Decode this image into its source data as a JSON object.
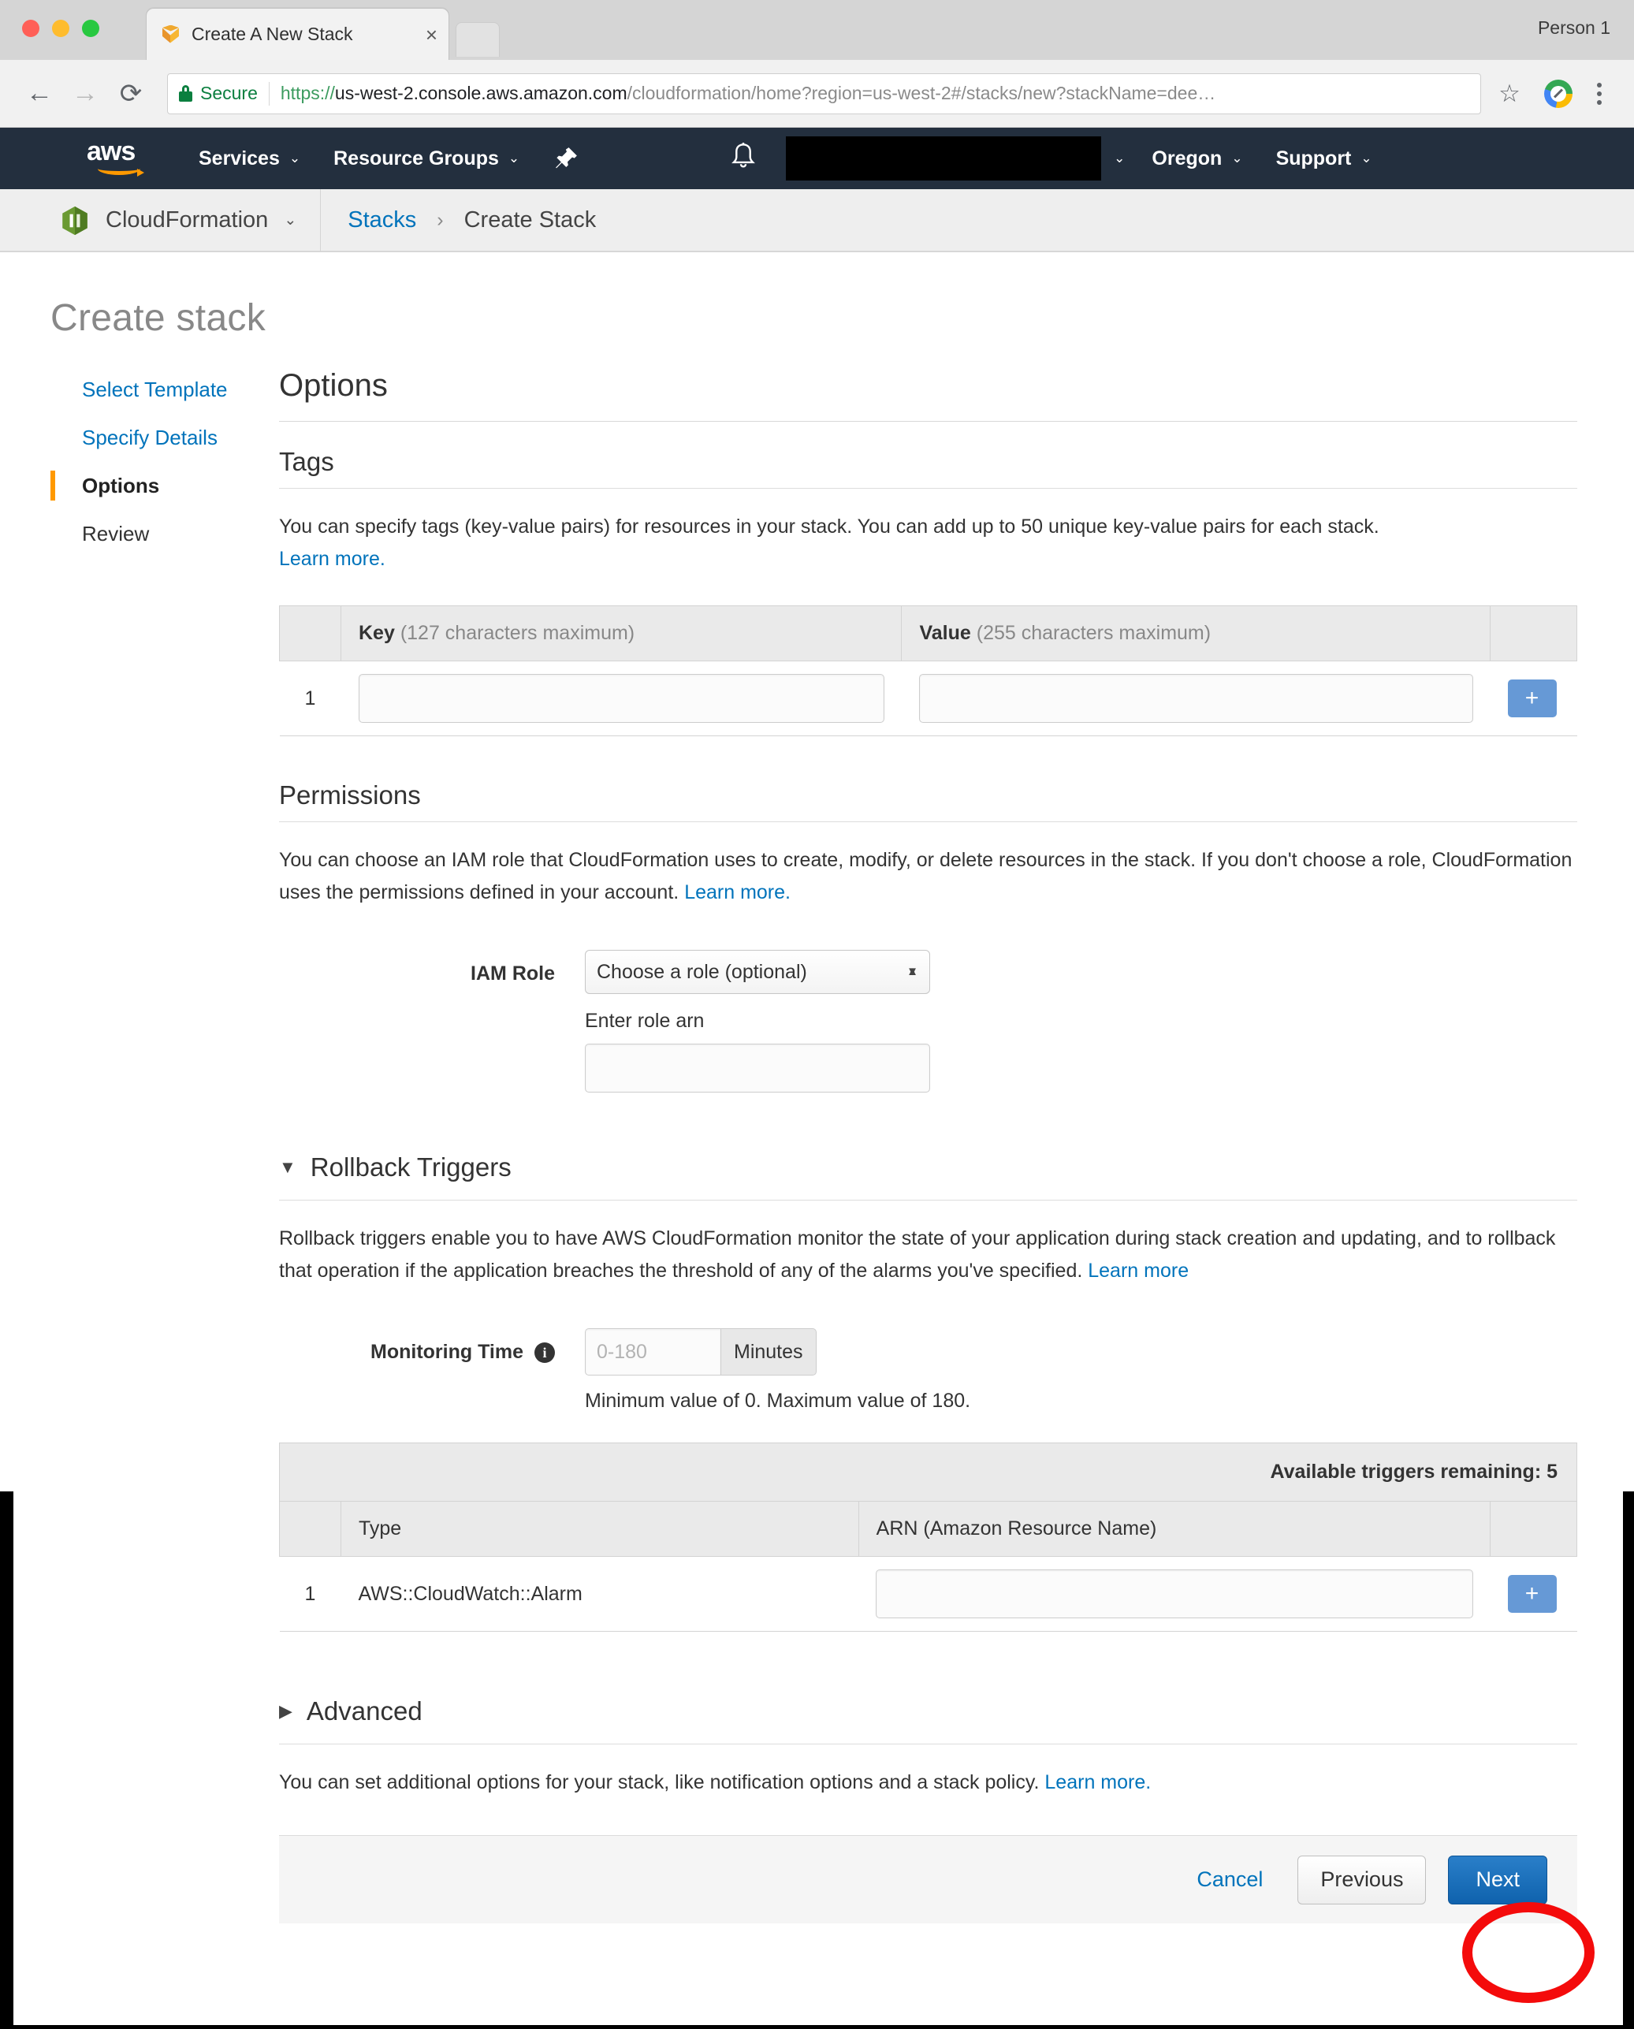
{
  "browser": {
    "tab": {
      "title": "Create A New Stack",
      "favicon": "cloudformation-cube-icon",
      "close": "×"
    },
    "profile_label": "Person 1",
    "nav": {
      "back": "←",
      "forward": "→",
      "reload": "⟳"
    },
    "omnibox": {
      "security_label": "Secure",
      "url_scheme": "https://",
      "url_host": "us-west-2.console.aws.amazon.com",
      "url_path": "/cloudformation/home?region=us-west-2#/stacks/new?stackName=dee…"
    }
  },
  "aws_nav": {
    "logo": "aws",
    "services": "Services",
    "resource_groups": "Resource Groups",
    "caret": "⌄",
    "region": "Oregon",
    "support": "Support"
  },
  "service_bar": {
    "service_name": "CloudFormation",
    "caret": "⌄",
    "breadcrumb_link": "Stacks",
    "breadcrumb_sep": "›",
    "breadcrumb_current": "Create Stack"
  },
  "page": {
    "title": "Create stack"
  },
  "sidebar": {
    "items": [
      {
        "label": "Select Template",
        "state": "link"
      },
      {
        "label": "Specify Details",
        "state": "link"
      },
      {
        "label": "Options",
        "state": "active"
      },
      {
        "label": "Review",
        "state": "plain"
      }
    ]
  },
  "main": {
    "section_title": "Options",
    "tags": {
      "heading": "Tags",
      "description": "You can specify tags (key-value pairs) for resources in your stack. You can add up to 50 unique key-value pairs for each stack.",
      "learn_more": "Learn more.",
      "columns": {
        "key_bold": "Key",
        "key_hint": "(127 characters maximum)",
        "value_bold": "Value",
        "value_hint": "(255 characters maximum)"
      },
      "rows": [
        {
          "number": "1",
          "key_value": "",
          "value_value": "",
          "add_label": "+"
        }
      ]
    },
    "permissions": {
      "heading": "Permissions",
      "description_part1": "You can choose an IAM role that CloudFormation uses to create, modify, or delete resources in the stack. If you don't choose a role, CloudFormation uses the permissions defined in your account.",
      "learn_more": "Learn more.",
      "iam_role_label": "IAM Role",
      "iam_role_selected": "Choose a role (optional)",
      "role_arn_label": "Enter role arn",
      "role_arn_value": ""
    },
    "rollback_triggers": {
      "heading": "Rollback Triggers",
      "expanded": true,
      "toggle_glyph": "▼",
      "description": "Rollback triggers enable you to have AWS CloudFormation monitor the state of your application during stack creation and updating, and to rollback that operation if the application breaches the threshold of any of the alarms you've specified.",
      "learn_more": "Learn more",
      "monitoring_time_label": "Monitoring Time",
      "monitoring_time_placeholder": "0-180",
      "monitoring_time_value": "",
      "monitoring_time_unit": "Minutes",
      "monitoring_time_helper": "Minimum value of 0. Maximum value of 180.",
      "available_banner": "Available triggers remaining: 5",
      "columns": {
        "type": "Type",
        "arn": "ARN (Amazon Resource Name)"
      },
      "rows": [
        {
          "number": "1",
          "type": "AWS::CloudWatch::Alarm",
          "arn_value": "",
          "add_label": "+"
        }
      ]
    },
    "advanced": {
      "heading": "Advanced",
      "expanded": false,
      "toggle_glyph": "▶",
      "description": "You can set additional options for your stack, like notification options and a stack policy.",
      "learn_more": "Learn more."
    }
  },
  "footer": {
    "cancel": "Cancel",
    "previous": "Previous",
    "next": "Next"
  },
  "colors": {
    "aws_navy": "#232f3e",
    "aws_orange": "#ff9900",
    "link_blue": "#0073bb",
    "primary_button": "#0f62ad",
    "annotation_red": "#f40b0b"
  }
}
